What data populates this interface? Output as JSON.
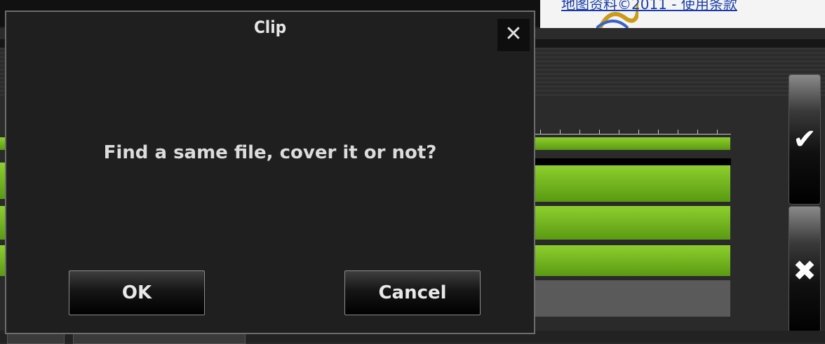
{
  "dialog": {
    "title": "Clip",
    "close_glyph": "✕",
    "message": "Find a same file, cover it or not?",
    "ok_label": "OK",
    "cancel_label": "Cancel"
  },
  "side_buttons": {
    "confirm_glyph": "✔",
    "reject_glyph": "✖"
  },
  "background_page": {
    "link_text": "地图资料©2011 - 使用条款"
  },
  "colors": {
    "track_green": "#7cc022",
    "dialog_bg": "#1f1f1f",
    "dialog_border": "#6d6d6d"
  }
}
